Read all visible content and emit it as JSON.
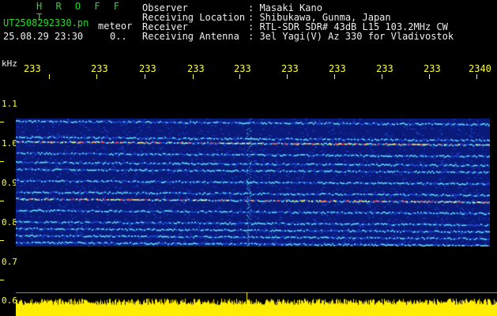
{
  "header": {
    "brand": "H R O F F T",
    "filename": "UT2508292330.pn",
    "tag": "meteor",
    "timestamp": "25.08.29 23:30",
    "timestamp_extra": "0..",
    "info": [
      {
        "label": "Observer",
        "value": ": Masaki Kano"
      },
      {
        "label": "Receiving Location",
        "value": ": Shibukawa, Gunma, Japan"
      },
      {
        "label": "Receiver",
        "value": ": RTL-SDR SDR# 43dB L15 103.2MHz CW"
      },
      {
        "label": "Receiving Antenna",
        "value": ": 3el Yagi(V) Az 330 for Vladivostok"
      }
    ]
  },
  "x_axis": {
    "unit": "kHz",
    "ticks": [
      "233",
      "233",
      "233",
      "233",
      "233",
      "233",
      "233",
      "233",
      "233",
      "2340"
    ]
  },
  "y_axis": {
    "ticks": [
      {
        "label": "1.1",
        "value": 1.1
      },
      {
        "label": "1.0",
        "value": 1.0
      },
      {
        "label": "0.9",
        "value": 0.9
      },
      {
        "label": "0.8",
        "value": 0.8
      },
      {
        "label": "0.7",
        "value": 0.7
      },
      {
        "label": "0.6",
        "value": 0.6
      }
    ]
  },
  "colors": {
    "background": "#000000",
    "axis": "#ffff33",
    "text": "#eeeeee",
    "brand": "#22dd22",
    "waterfall_dark": "#0a1a7a",
    "waterfall_mid": "#1f4fe0",
    "trace_cyan": "#5fe8ff",
    "trace_red": "#ff4040",
    "baseline": "#ffee00"
  },
  "chart_data": {
    "type": "heatmap",
    "y_range": [
      0.6,
      1.15
    ],
    "band_range": [
      0.76,
      1.04
    ],
    "traces": [
      1.035,
      1.0,
      0.99,
      0.965,
      0.945,
      0.93,
      0.905,
      0.88,
      0.865,
      0.84,
      0.815,
      0.8,
      0.785,
      0.77
    ],
    "strong_traces": [
      0.99,
      0.865
    ],
    "baseline_level": 0.6
  }
}
